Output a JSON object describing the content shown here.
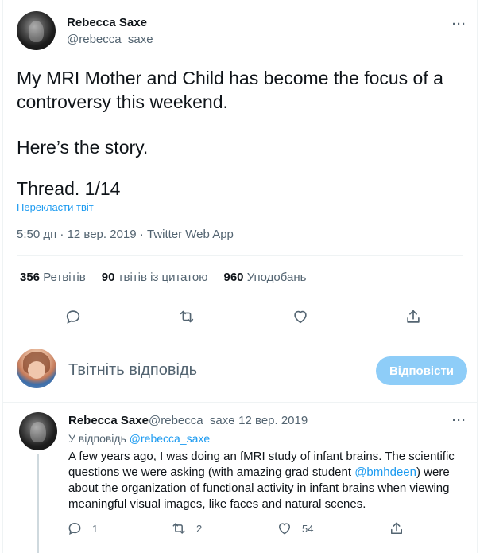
{
  "main_tweet": {
    "author_name": "Rebecca Saxe",
    "author_handle": "@rebecca_saxe",
    "more_label": "···",
    "text_line1": "My MRI Mother and Child has become the focus of a",
    "text_line2": "controversy this weekend.",
    "text_line3": "Here’s the story.",
    "text_line4": "Thread. 1/14",
    "translate_label": "Перекласти твіт",
    "meta": "5:50 дп · 12 вер. 2019 · Twitter Web App",
    "stats": {
      "retweets_count": "356",
      "retweets_label": "Ретвітів",
      "quotes_count": "90",
      "quotes_label": "твітів із цитатою",
      "likes_count": "960",
      "likes_label": "Уподобань"
    },
    "icons": [
      "reply-icon",
      "retweet-icon",
      "like-icon",
      "share-icon"
    ]
  },
  "composer": {
    "placeholder": "Твітніть відповідь",
    "reply_button": "Відповісти"
  },
  "reply_tweet": {
    "author_name": "Rebecca Saxe",
    "author_handle": "@rebecca_saxe",
    "date": "· 12 вер. 2019",
    "more_label": "···",
    "reply_to_prefix": "У відповідь",
    "reply_to_handle": "@rebecca_saxe",
    "text_part1": "A few years ago, I was doing an fMRI study of infant brains. The scientific questions we were asking (with amazing grad student ",
    "text_mention": "@bmhdeen",
    "text_part2": ") were about the organization of functional activity in infant brains when viewing meaningful visual images, like faces and natural scenes.",
    "reply_count": "1",
    "retweet_count": "2",
    "like_count": "54"
  },
  "colors": {
    "accent": "#1d9bf0",
    "text": "#0f1419",
    "muted": "#536471",
    "reply_button_bg": "#8ecdf8"
  }
}
